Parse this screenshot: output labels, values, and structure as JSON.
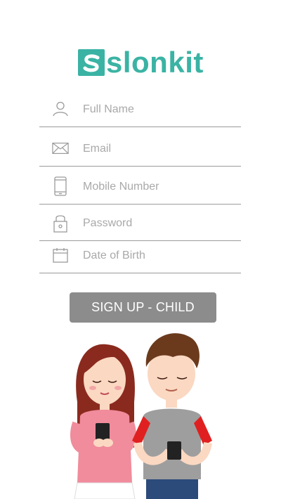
{
  "app": {
    "logo_text": "slonkit"
  },
  "form": {
    "fields": [
      {
        "placeholder": "Full Name",
        "icon": "person-icon"
      },
      {
        "placeholder": "Email",
        "icon": "envelope-icon"
      },
      {
        "placeholder": "Mobile Number",
        "icon": "mobile-phone-icon"
      },
      {
        "placeholder": "Password",
        "icon": "lock-icon"
      },
      {
        "placeholder": "Date of Birth",
        "icon": "calendar-icon"
      }
    ],
    "submit_label": "SIGN UP - CHILD"
  },
  "colors": {
    "brand": "#3ab3a4",
    "button": "#8c8c8c",
    "placeholder": "#a9a9a9"
  }
}
